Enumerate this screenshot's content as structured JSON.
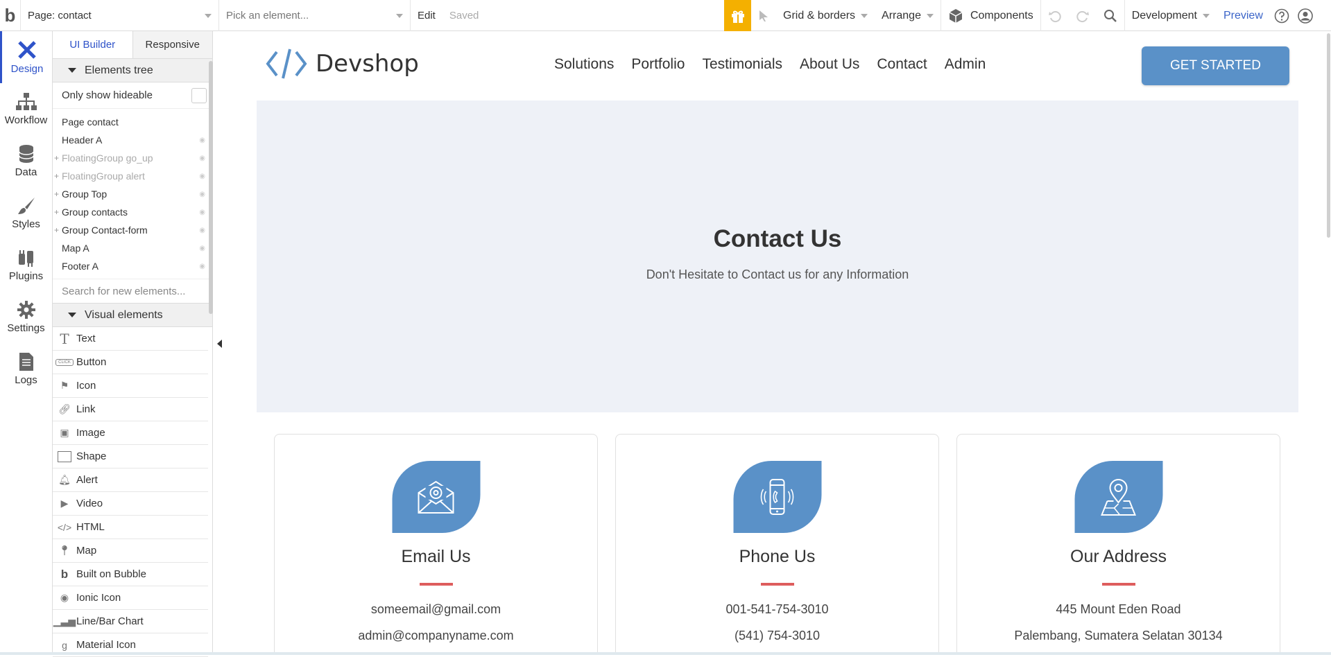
{
  "topbar": {
    "logo": "b",
    "page_select": "Page: contact",
    "element_select_placeholder": "Pick an element...",
    "edit": "Edit",
    "saved": "Saved",
    "grid": "Grid & borders",
    "arrange": "Arrange",
    "components": "Components",
    "environment": "Development",
    "preview": "Preview"
  },
  "rail": {
    "design": "Design",
    "workflow": "Workflow",
    "data": "Data",
    "styles": "Styles",
    "plugins": "Plugins",
    "settings": "Settings",
    "logs": "Logs"
  },
  "panel": {
    "tab_builder": "UI Builder",
    "tab_responsive": "Responsive",
    "tree_header": "Elements tree",
    "only_hideable": "Only show hideable",
    "tree": [
      "Page contact",
      "Header A",
      "FloatingGroup go_up",
      "FloatingGroup alert",
      "Group Top",
      "Group contacts",
      "Group Contact-form",
      "Map A",
      "Footer A"
    ],
    "search_placeholder": "Search for new elements...",
    "visual_header": "Visual elements",
    "visual": [
      "Text",
      "Button",
      "Icon",
      "Link",
      "Image",
      "Shape",
      "Alert",
      "Video",
      "HTML",
      "Map",
      "Built on Bubble",
      "Ionic Icon",
      "Line/Bar Chart",
      "Material Icon"
    ]
  },
  "site": {
    "brand": "Devshop",
    "nav": [
      "Solutions",
      "Portfolio",
      "Testimonials",
      "About Us",
      "Contact",
      "Admin"
    ],
    "cta": "GET STARTED",
    "hero_title": "Contact Us",
    "hero_sub": "Don't Hesitate to Contact us for any Information",
    "cards": [
      {
        "title": "Email Us",
        "line1": "someemail@gmail.com",
        "line2": "admin@companyname.com"
      },
      {
        "title": "Phone Us",
        "line1": "001-541-754-3010",
        "line2": "(541) 754-3010"
      },
      {
        "title": "Our Address",
        "line1": "445 Mount Eden Road",
        "line2": "Palembang, Sumatera Selatan 30134"
      }
    ]
  },
  "colors": {
    "accent_blue": "#5a91c8",
    "bubble_blue": "#2f53c9",
    "gift": "#f4b000",
    "hero_bg": "#eef1f7",
    "rule_red": "#de5d5d"
  }
}
